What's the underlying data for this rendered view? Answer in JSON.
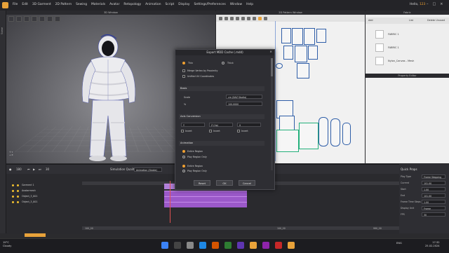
{
  "menubar": {
    "items": [
      "File",
      "Edit",
      "3D Garment",
      "2D Pattern",
      "Sewing",
      "Materials",
      "Avatar",
      "Retopology",
      "Animation",
      "Script",
      "Display",
      "Settings/Preferences",
      "Window",
      "Help"
    ],
    "greeting": "Hello,",
    "user": "123"
  },
  "left_tool": {
    "label": "Scene"
  },
  "view3d": {
    "title": "3D Window"
  },
  "pattern": {
    "title": "2D Pattern Window"
  },
  "dialog": {
    "title": "Export MDD Cache (.mdd)",
    "option_thin": "Thin",
    "option_thick": "Thick",
    "merge_label": "Merge Vertex by Proximity",
    "unified_label": "Unified UV Coordinates",
    "basis_header": "Basis",
    "scale_label": "Scale",
    "scale_value": "cm (DAZ Studio)",
    "pct_label": "%",
    "pct_value": "100.0000",
    "axis_header": "Axis Conversion",
    "axis_x": "Y",
    "axis_y": "Z (Up)",
    "axis_z": "X",
    "invert1": "Invert",
    "invert2": "Invert",
    "invert3": "Invert",
    "animation_header": "Animation",
    "entire_range": "Entire Region",
    "play_region": "Play Region Only",
    "entire_range2": "Entire Region",
    "play_region2": "Play Region Only",
    "reset": "Reset",
    "ok": "OK",
    "cancel": "Cancel"
  },
  "fabric": {
    "title": "Fabric",
    "add": "Add",
    "list": "List",
    "delete_unused": "Delete Unused",
    "items": [
      "FABRIC 1",
      "FABRIC 1",
      "Nylon_Canvas - Mesh"
    ]
  },
  "property_editor": {
    "title": "Property Editor"
  },
  "timeline": {
    "frame": "180",
    "fps": "30",
    "simulation_quality": "Simulation Quality",
    "animation_mode": "Animation (Stable)",
    "rows": [
      "Garment 1",
      "Avatarmesh",
      "Object_3_001",
      "Object_3_001"
    ],
    "start_label": "100_00",
    "end_label": "990_00",
    "range_label": "100_00"
  },
  "quick_props": {
    "title": "Quick Props",
    "rows": [
      {
        "label": "Play Type",
        "value": "Frame Stepping"
      },
      {
        "label": "Current",
        "value": "101.00"
      },
      {
        "label": "Start",
        "value": "1.00"
      },
      {
        "label": "End",
        "value": "101.00"
      },
      {
        "label": "Frame Time Steps",
        "value": "1.00"
      },
      {
        "label": "Display Unit",
        "value": "Frame"
      },
      {
        "label": "FPS",
        "value": "30"
      }
    ]
  },
  "taskbar": {
    "temp": "19°C",
    "weather": "Cloudy",
    "lang": "ENG",
    "time": "17:32",
    "date": "25.02.2024",
    "icon_colors": [
      "#3b82f6",
      "#444",
      "#888",
      "#1e88e5",
      "#d35400",
      "#2e7d32",
      "#5e35b1",
      "#e8a23a",
      "#8e24aa",
      "#c62828",
      "#e8a23a"
    ]
  }
}
